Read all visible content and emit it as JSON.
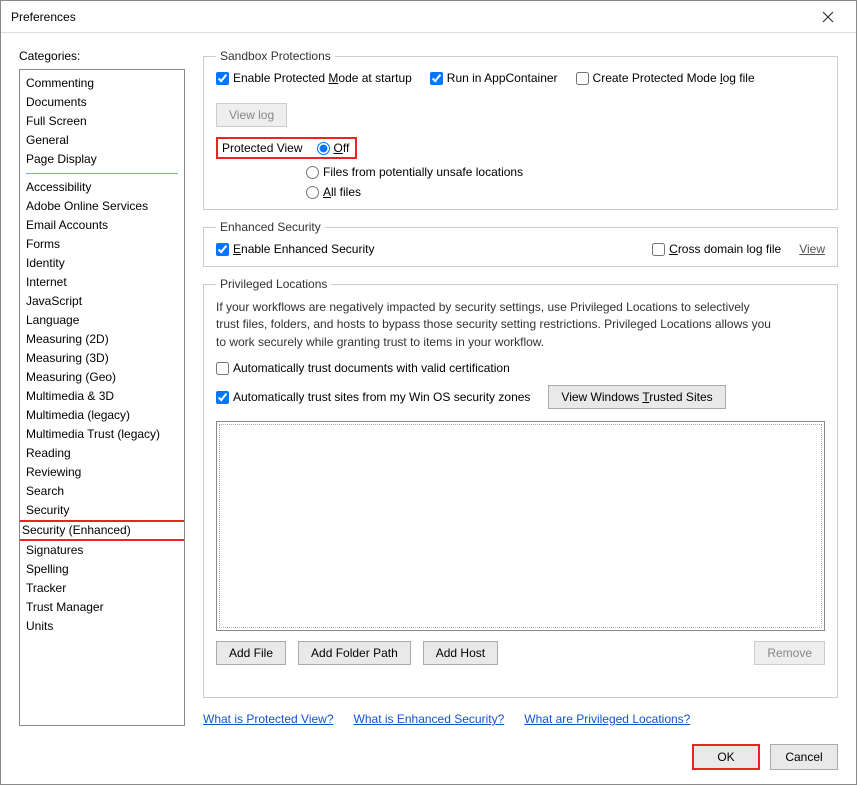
{
  "window": {
    "title": "Preferences"
  },
  "categories_label": "Categories:",
  "categories_top": [
    "Commenting",
    "Documents",
    "Full Screen",
    "General",
    "Page Display"
  ],
  "categories_bottom": [
    "Accessibility",
    "Adobe Online Services",
    "Email Accounts",
    "Forms",
    "Identity",
    "Internet",
    "JavaScript",
    "Language",
    "Measuring (2D)",
    "Measuring (3D)",
    "Measuring (Geo)",
    "Multimedia & 3D",
    "Multimedia (legacy)",
    "Multimedia Trust (legacy)",
    "Reading",
    "Reviewing",
    "Search",
    "Security",
    "Security (Enhanced)",
    "Signatures",
    "Spelling",
    "Tracker",
    "Trust Manager",
    "Units"
  ],
  "selected_category": "Security (Enhanced)",
  "sandbox": {
    "legend": "Sandbox Protections",
    "enable_protected_mode": {
      "pre": "Enable Protected ",
      "u": "M",
      "post": "ode at startup",
      "checked": true
    },
    "run_appcontainer": {
      "label": "Run in AppContainer",
      "checked": true
    },
    "create_log": {
      "pre": "Create Protected Mode ",
      "u": "l",
      "post": "og file",
      "checked": false
    },
    "view_log_btn": "View log",
    "protected_view_label": "Protected View",
    "pv_off": {
      "u": "O",
      "post": "ff",
      "checked": true
    },
    "pv_unsafe": {
      "label": "Files from potentially unsafe locations",
      "checked": false
    },
    "pv_all": {
      "u": "A",
      "post": "ll files",
      "checked": false
    }
  },
  "enhanced": {
    "legend": "Enhanced Security",
    "enable": {
      "u": "E",
      "post": "nable Enhanced Security",
      "checked": true
    },
    "cross_domain": {
      "u": "C",
      "post": "ross domain log file",
      "checked": false
    },
    "view_link": "View"
  },
  "privileged": {
    "legend": "Privileged Locations",
    "help": "If your workflows are negatively impacted by security settings, use Privileged Locations to selectively trust files, folders, and hosts to bypass those security setting restrictions. Privileged Locations allows you to work securely while granting trust to items in your workflow.",
    "auto_trust_cert": {
      "label": "Automatically trust documents with valid certification",
      "checked": false
    },
    "auto_trust_zones": {
      "label": "Automatically trust sites from my Win OS security zones",
      "checked": true
    },
    "view_trusted_btn": {
      "pre": "View Windows ",
      "u": "T",
      "post": "rusted Sites"
    },
    "add_file": "Add File",
    "add_folder": "Add Folder Path",
    "add_host": "Add Host",
    "remove": "Remove"
  },
  "links": {
    "what_pv": "What is Protected View?",
    "what_es": "What is Enhanced Security?",
    "what_pl": "What are Privileged Locations?"
  },
  "footer": {
    "ok": "OK",
    "cancel": "Cancel"
  }
}
